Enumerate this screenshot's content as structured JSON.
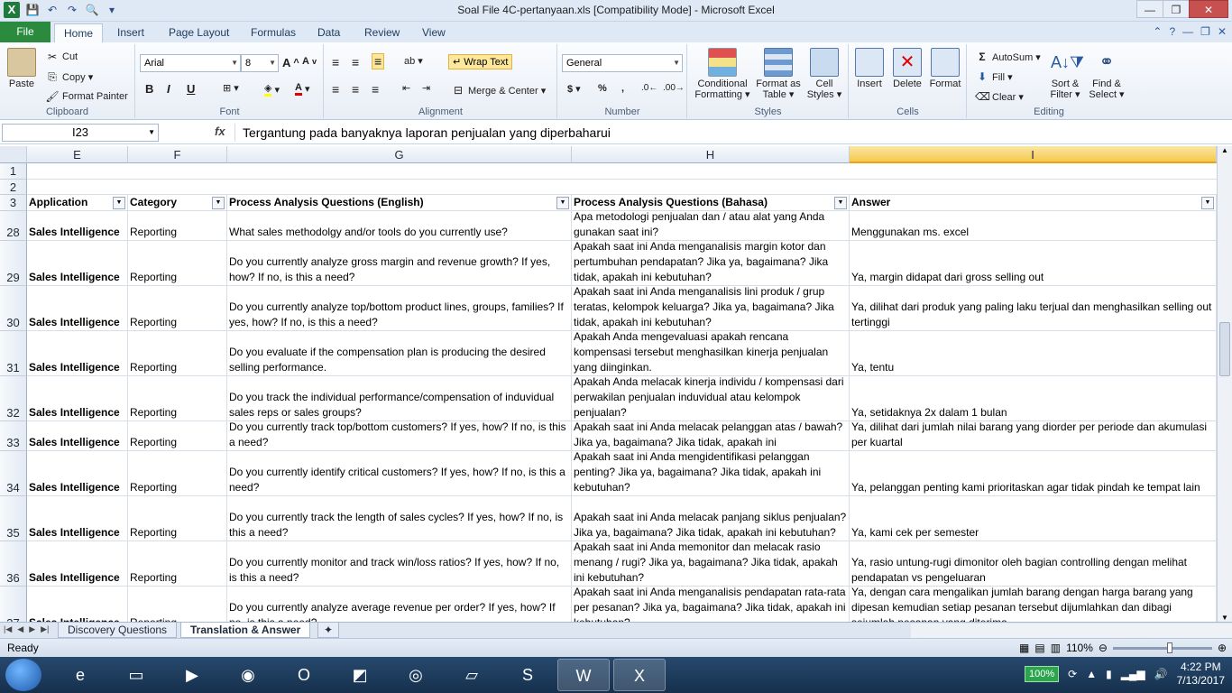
{
  "window": {
    "title": "Soal File 4C-pertanyaan.xls  [Compatibility Mode]  -  Microsoft Excel",
    "buttons": [
      "—",
      "❐",
      "✕"
    ]
  },
  "tabs": [
    "File",
    "Home",
    "Insert",
    "Page Layout",
    "Formulas",
    "Data",
    "Review",
    "View"
  ],
  "ribbon": {
    "clipboard": {
      "label": "Clipboard",
      "paste": "Paste",
      "cut": "Cut",
      "copy": "Copy ▾",
      "format_painter": "Format Painter"
    },
    "font": {
      "label": "Font",
      "name": "Arial",
      "size": "8",
      "bold": "B",
      "italic": "I",
      "underline": "U"
    },
    "alignment": {
      "label": "Alignment",
      "wrap_text": "Wrap Text",
      "merge_center": "Merge & Center ▾"
    },
    "number": {
      "label": "Number",
      "format": "General",
      "currency": "$ ▾",
      "percent": "%",
      "comma": ","
    },
    "styles": {
      "label": "Styles",
      "conditional": "Conditional Formatting ▾",
      "format_table": "Format as Table ▾",
      "cell_styles": "Cell Styles ▾"
    },
    "cells": {
      "label": "Cells",
      "insert": "Insert",
      "delete": "Delete",
      "format": "Format"
    },
    "editing": {
      "label": "Editing",
      "autosum": "AutoSum ▾",
      "fill": "Fill ▾",
      "clear": "Clear ▾",
      "sort_filter": "Sort & Filter ▾",
      "find_select": "Find & Select ▾"
    }
  },
  "formula_bar": {
    "name_box": "I23",
    "fx": "fx",
    "value": "Tergantung pada banyaknya laporan penjualan yang diperbaharui"
  },
  "grid": {
    "columns": [
      "E",
      "F",
      "G",
      "H",
      "I"
    ],
    "header_row": {
      "number": "3",
      "cells": [
        "Application",
        "Category",
        "Process Analysis Questions (English)",
        "Process Analysis Questions (Bahasa)",
        "Answer"
      ]
    },
    "blank_rows": [
      "1",
      "2"
    ],
    "rows": [
      {
        "num": "28",
        "app": "Sales Intelligence",
        "cat": "Reporting",
        "en": "What sales methodolgy and/or tools do you currently use?",
        "id": "Apa metodologi penjualan dan / atau alat yang Anda gunakan saat ini?",
        "ans": "Menggunakan ms. excel"
      },
      {
        "num": "29",
        "app": "Sales Intelligence",
        "cat": "Reporting",
        "en": "Do you currently analyze gross margin and revenue growth?  If yes, how?  If no, is this a need?",
        "id": "Apakah saat ini Anda menganalisis margin kotor dan pertumbuhan pendapatan? Jika ya, bagaimana? Jika tidak, apakah ini kebutuhan?",
        "ans": "Ya, margin didapat dari gross selling out"
      },
      {
        "num": "30",
        "app": "Sales Intelligence",
        "cat": "Reporting",
        "en": "Do you currently analyze top/bottom product lines, groups, families?  If yes, how?  If no, is this a need?",
        "id": "Apakah saat ini Anda menganalisis lini produk / grup teratas, kelompok keluarga? Jika ya, bagaimana? Jika tidak, apakah ini kebutuhan?",
        "ans": "Ya, dilihat dari produk yang paling laku terjual dan menghasilkan selling out tertinggi"
      },
      {
        "num": "31",
        "app": "Sales Intelligence",
        "cat": "Reporting",
        "en": "Do you evaluate if the compensation plan is producing the desired selling performance.",
        "id": "Apakah Anda mengevaluasi apakah rencana kompensasi tersebut menghasilkan kinerja penjualan yang diinginkan.",
        "ans": "Ya, tentu"
      },
      {
        "num": "32",
        "app": "Sales Intelligence",
        "cat": "Reporting",
        "en": "Do you track the individual performance/compensation of induvidual sales reps or sales groups?",
        "id": "Apakah Anda melacak kinerja individu / kompensasi dari perwakilan penjualan induvidual atau kelompok penjualan?",
        "ans": "Ya, setidaknya 2x dalam 1 bulan"
      },
      {
        "num": "33",
        "app": "Sales Intelligence",
        "cat": "Reporting",
        "en": "Do you currently track top/bottom customers?  If yes, how?  If no, is this a need?",
        "id": "Apakah saat ini Anda melacak pelanggan atas / bawah? Jika ya, bagaimana? Jika tidak, apakah ini",
        "ans": "Ya, dilihat dari jumlah nilai barang yang diorder per periode dan akumulasi per kuartal"
      },
      {
        "num": "34",
        "app": "Sales Intelligence",
        "cat": "Reporting",
        "en": "Do you currently identify critical customers?  If yes, how?  If no, is this a need?",
        "id": "Apakah saat ini Anda mengidentifikasi pelanggan penting? Jika ya, bagaimana? Jika tidak, apakah ini kebutuhan?",
        "ans": "Ya, pelanggan penting kami prioritaskan agar tidak pindah ke tempat lain"
      },
      {
        "num": "35",
        "app": "Sales Intelligence",
        "cat": "Reporting",
        "en": "Do you currently track the length of sales cycles?  If yes, how?  If no, is this a need?",
        "id": "Apakah saat ini Anda melacak panjang siklus penjualan? Jika ya, bagaimana? Jika tidak, apakah ini kebutuhan?",
        "ans": "Ya, kami cek per semester"
      },
      {
        "num": "36",
        "app": "Sales Intelligence",
        "cat": "Reporting",
        "en": "Do you currently monitor and track win/loss ratios?  If yes, how?  If no, is this a need?",
        "id": "Apakah saat ini Anda memonitor dan melacak rasio menang / rugi? Jika ya, bagaimana? Jika tidak, apakah ini kebutuhan?",
        "ans": "Ya, rasio untung-rugi dimonitor oleh bagian controlling dengan melihat pendapatan vs pengeluaran"
      },
      {
        "num": "37",
        "app": "Sales Intelligence",
        "cat": "Reporting",
        "en": "Do you currently analyze average revenue per order?  If yes, how?  If no, is this a need?",
        "id": "Apakah saat ini Anda menganalisis pendapatan rata-rata per pesanan? Jika ya, bagaimana? Jika tidak, apakah ini kebutuhan?",
        "ans": "Ya, dengan cara mengalikan jumlah barang dengan harga barang yang dipesan kemudian setiap pesanan tersebut dijumlahkan dan dibagi sejumlah pesanan yang diterima"
      }
    ]
  },
  "sheets": [
    "Discovery Questions",
    "Translation & Answer"
  ],
  "active_sheet": "Translation & Answer",
  "status": {
    "ready": "Ready",
    "zoom": "110%"
  },
  "taskbar": {
    "battery": "100%",
    "time": "4:22 PM",
    "date": "7/13/2017"
  }
}
